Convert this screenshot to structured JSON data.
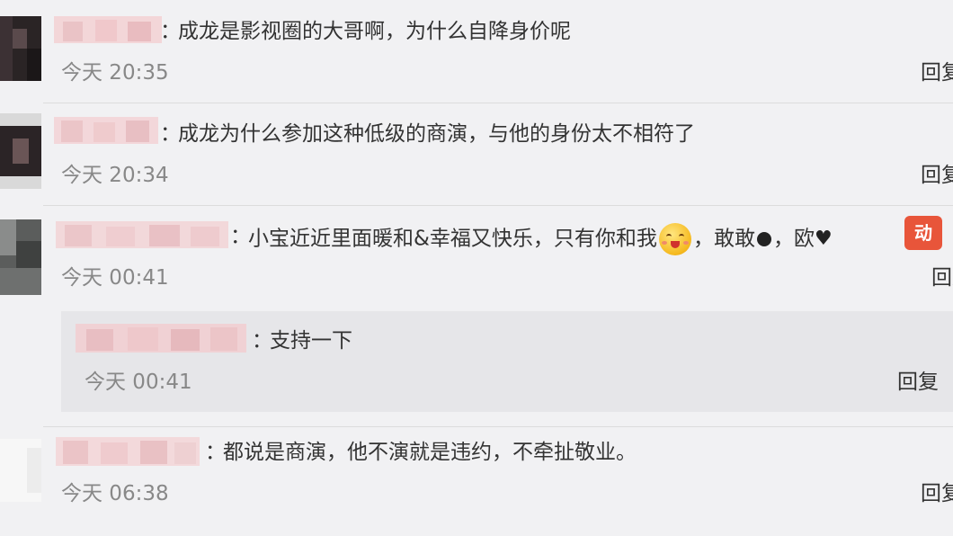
{
  "comments": [
    {
      "separator": "：",
      "text": "成龙是影视圈的大哥啊，为什么自降身价呢",
      "time": "今天 20:35",
      "reply_label": "回复"
    },
    {
      "separator": "：",
      "text": "成龙为什么参加这种低级的商演，与他的身份太不相符了",
      "time": "今天 20:34",
      "reply_label": "回复"
    },
    {
      "separator": "：",
      "text_part1": "小宝近近里面暖和&幸福又快乐，只有你和我",
      "text_part2": "，敢敢",
      "text_part3": "，欧",
      "time": "今天 00:41",
      "reply_label": "回复",
      "badge_text": "动",
      "emoji_icon": "grinning-emoji-icon",
      "sub_reply": {
        "separator": "：",
        "text": "支持一下",
        "time": "今天 00:41",
        "reply_label": "回复"
      }
    },
    {
      "separator": "：",
      "text": "都说是商演，他不演就是违约，不牵扯敬业。",
      "time": "今天 06:38",
      "reply_label": "回复"
    }
  ],
  "colors": {
    "background": "#f1f1f3",
    "sub_reply_background": "#e6e6e9",
    "time_text": "#888888",
    "badge": "#e8553a"
  }
}
